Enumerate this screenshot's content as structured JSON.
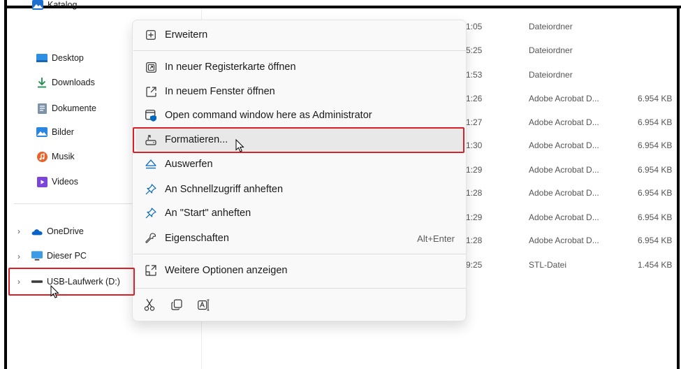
{
  "sidebar": {
    "top_item": {
      "label": "Katalog",
      "icon": "image-folder-icon"
    },
    "items": [
      {
        "label": "Desktop",
        "icon": "desktop-icon"
      },
      {
        "label": "Downloads",
        "icon": "download-arrow-icon"
      },
      {
        "label": "Dokumente",
        "icon": "document-icon"
      },
      {
        "label": "Bilder",
        "icon": "pictures-icon"
      },
      {
        "label": "Musik",
        "icon": "music-icon"
      },
      {
        "label": "Videos",
        "icon": "videos-icon"
      }
    ],
    "drives": [
      {
        "label": "OneDrive",
        "icon": "cloud-icon"
      },
      {
        "label": "Dieser PC",
        "icon": "monitor-icon"
      },
      {
        "label": "USB-Laufwerk (D:)",
        "icon": "usb-drive-icon"
      }
    ]
  },
  "files": {
    "rows": [
      {
        "time": "1:05",
        "type": "Dateiordner",
        "size": ""
      },
      {
        "time": "5:25",
        "type": "Dateiordner",
        "size": ""
      },
      {
        "time": "1:53",
        "type": "Dateiordner",
        "size": ""
      },
      {
        "time": "1:26",
        "type": "Adobe Acrobat D...",
        "size": "6.954 KB"
      },
      {
        "time": "1:27",
        "type": "Adobe Acrobat D...",
        "size": "6.954 KB"
      },
      {
        "time": "1:30",
        "type": "Adobe Acrobat D...",
        "size": "6.954 KB"
      },
      {
        "time": "1:29",
        "type": "Adobe Acrobat D...",
        "size": "6.954 KB"
      },
      {
        "time": "1:28",
        "type": "Adobe Acrobat D...",
        "size": "6.954 KB"
      },
      {
        "time": "1:29",
        "type": "Adobe Acrobat D...",
        "size": "6.954 KB"
      },
      {
        "time": "1:28",
        "type": "Adobe Acrobat D...",
        "size": "6.954 KB"
      },
      {
        "time": "9:25",
        "type": "STL-Datei",
        "size": "1.454 KB"
      }
    ]
  },
  "context_menu": {
    "items": [
      {
        "label": "Erweitern",
        "icon": "expand-plus-icon"
      },
      {
        "label": "In neuer Registerkarte öffnen",
        "icon": "open-new-tab-icon"
      },
      {
        "label": "In neuem Fenster öffnen",
        "icon": "open-new-window-icon"
      },
      {
        "label": "Open command window here as Administrator",
        "icon": "admin-command-icon"
      },
      {
        "label": "Formatieren...",
        "icon": "format-drive-icon"
      },
      {
        "label": "Auswerfen",
        "icon": "eject-icon"
      },
      {
        "label": "An Schnellzugriff anheften",
        "icon": "pin-icon"
      },
      {
        "label": "An \"Start\" anheften",
        "icon": "pin-icon"
      },
      {
        "label": "Eigenschaften",
        "icon": "properties-wrench-icon",
        "accelerator": "Alt+Enter"
      },
      {
        "label": "Weitere Optionen anzeigen",
        "icon": "more-options-icon"
      }
    ],
    "quick_actions": [
      {
        "icon": "cut-scissors-icon"
      },
      {
        "icon": "copy-icon"
      },
      {
        "icon": "rename-icon"
      }
    ]
  },
  "colors": {
    "highlight_box": "#d92027",
    "accent_blue": "#0067c0",
    "hover_bg": "#e8e8e8"
  }
}
